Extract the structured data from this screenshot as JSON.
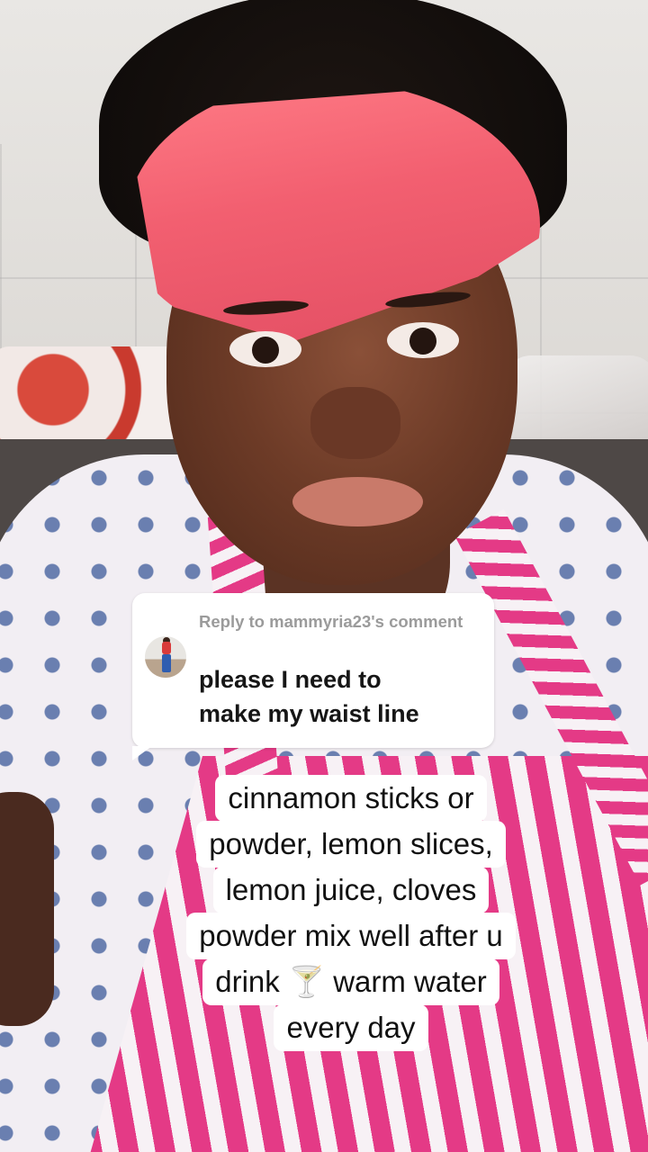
{
  "reply": {
    "header": "Reply to mammyria23's comment",
    "comment_lines": [
      "please I need to",
      "make my waist line"
    ]
  },
  "caption": {
    "lines": [
      "cinnamon sticks or",
      "powder, lemon slices,",
      "lemon juice, cloves",
      "powder  mix  well  after u",
      "drink 🍸 warm  water",
      "every day"
    ]
  },
  "colors": {
    "card_background": "#ffffff",
    "header_gray": "#9b9b9b",
    "text_dark": "#161616",
    "headband_pink": "#f25f70",
    "apron_pink": "#e43a86"
  }
}
